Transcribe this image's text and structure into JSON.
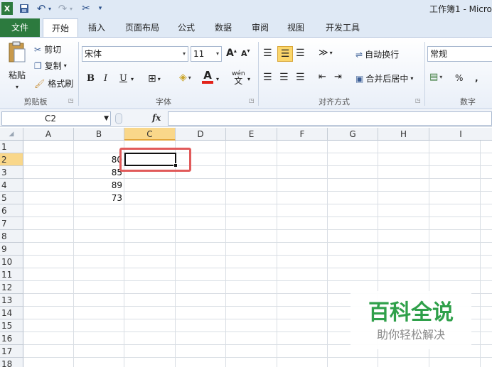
{
  "window": {
    "title": "工作簿1 - Micro",
    "qat": {
      "app_icon": "X",
      "undo": "↶",
      "redo": "↷"
    }
  },
  "ribbon": {
    "tabs": [
      "文件",
      "开始",
      "插入",
      "页面布局",
      "公式",
      "数据",
      "审阅",
      "视图",
      "开发工具"
    ],
    "clipboard": {
      "paste": "粘贴",
      "cut": "剪切",
      "copy": "复制",
      "format_painter": "格式刷",
      "label": "剪贴板"
    },
    "font": {
      "name": "宋体",
      "size": "11",
      "label": "字体",
      "bold": "B",
      "italic": "I",
      "underline": "U",
      "grow": "A",
      "shrink": "A",
      "phonetic": "wén",
      "font_color_glyph": "A"
    },
    "alignment": {
      "wrap": "自动换行",
      "merge": "合并后居中",
      "label": "对齐方式"
    },
    "number": {
      "format": "常规",
      "label": "数字",
      "percent": "%",
      "comma": ","
    }
  },
  "formula_bar": {
    "name_box": "C2",
    "fx": "fx",
    "value": ""
  },
  "grid": {
    "columns": [
      "A",
      "B",
      "C",
      "D",
      "E",
      "F",
      "G",
      "H",
      "I"
    ],
    "rows": [
      "1",
      "2",
      "3",
      "4",
      "5",
      "6",
      "7",
      "8",
      "9",
      "10",
      "11",
      "12",
      "13",
      "14",
      "15",
      "16",
      "17",
      "18"
    ],
    "selected_column": "C",
    "selected_row": "2",
    "cells": {
      "B2": "80",
      "B3": "85",
      "B4": "89",
      "B5": "73"
    }
  },
  "watermark": {
    "title": "百科全说",
    "subtitle": "助你轻松解决"
  },
  "colors": {
    "file_tab": "#2c7a3e",
    "highlight": "#e15a5a",
    "selected_header": "#f9d78a",
    "watermark": "#2fa04a"
  }
}
